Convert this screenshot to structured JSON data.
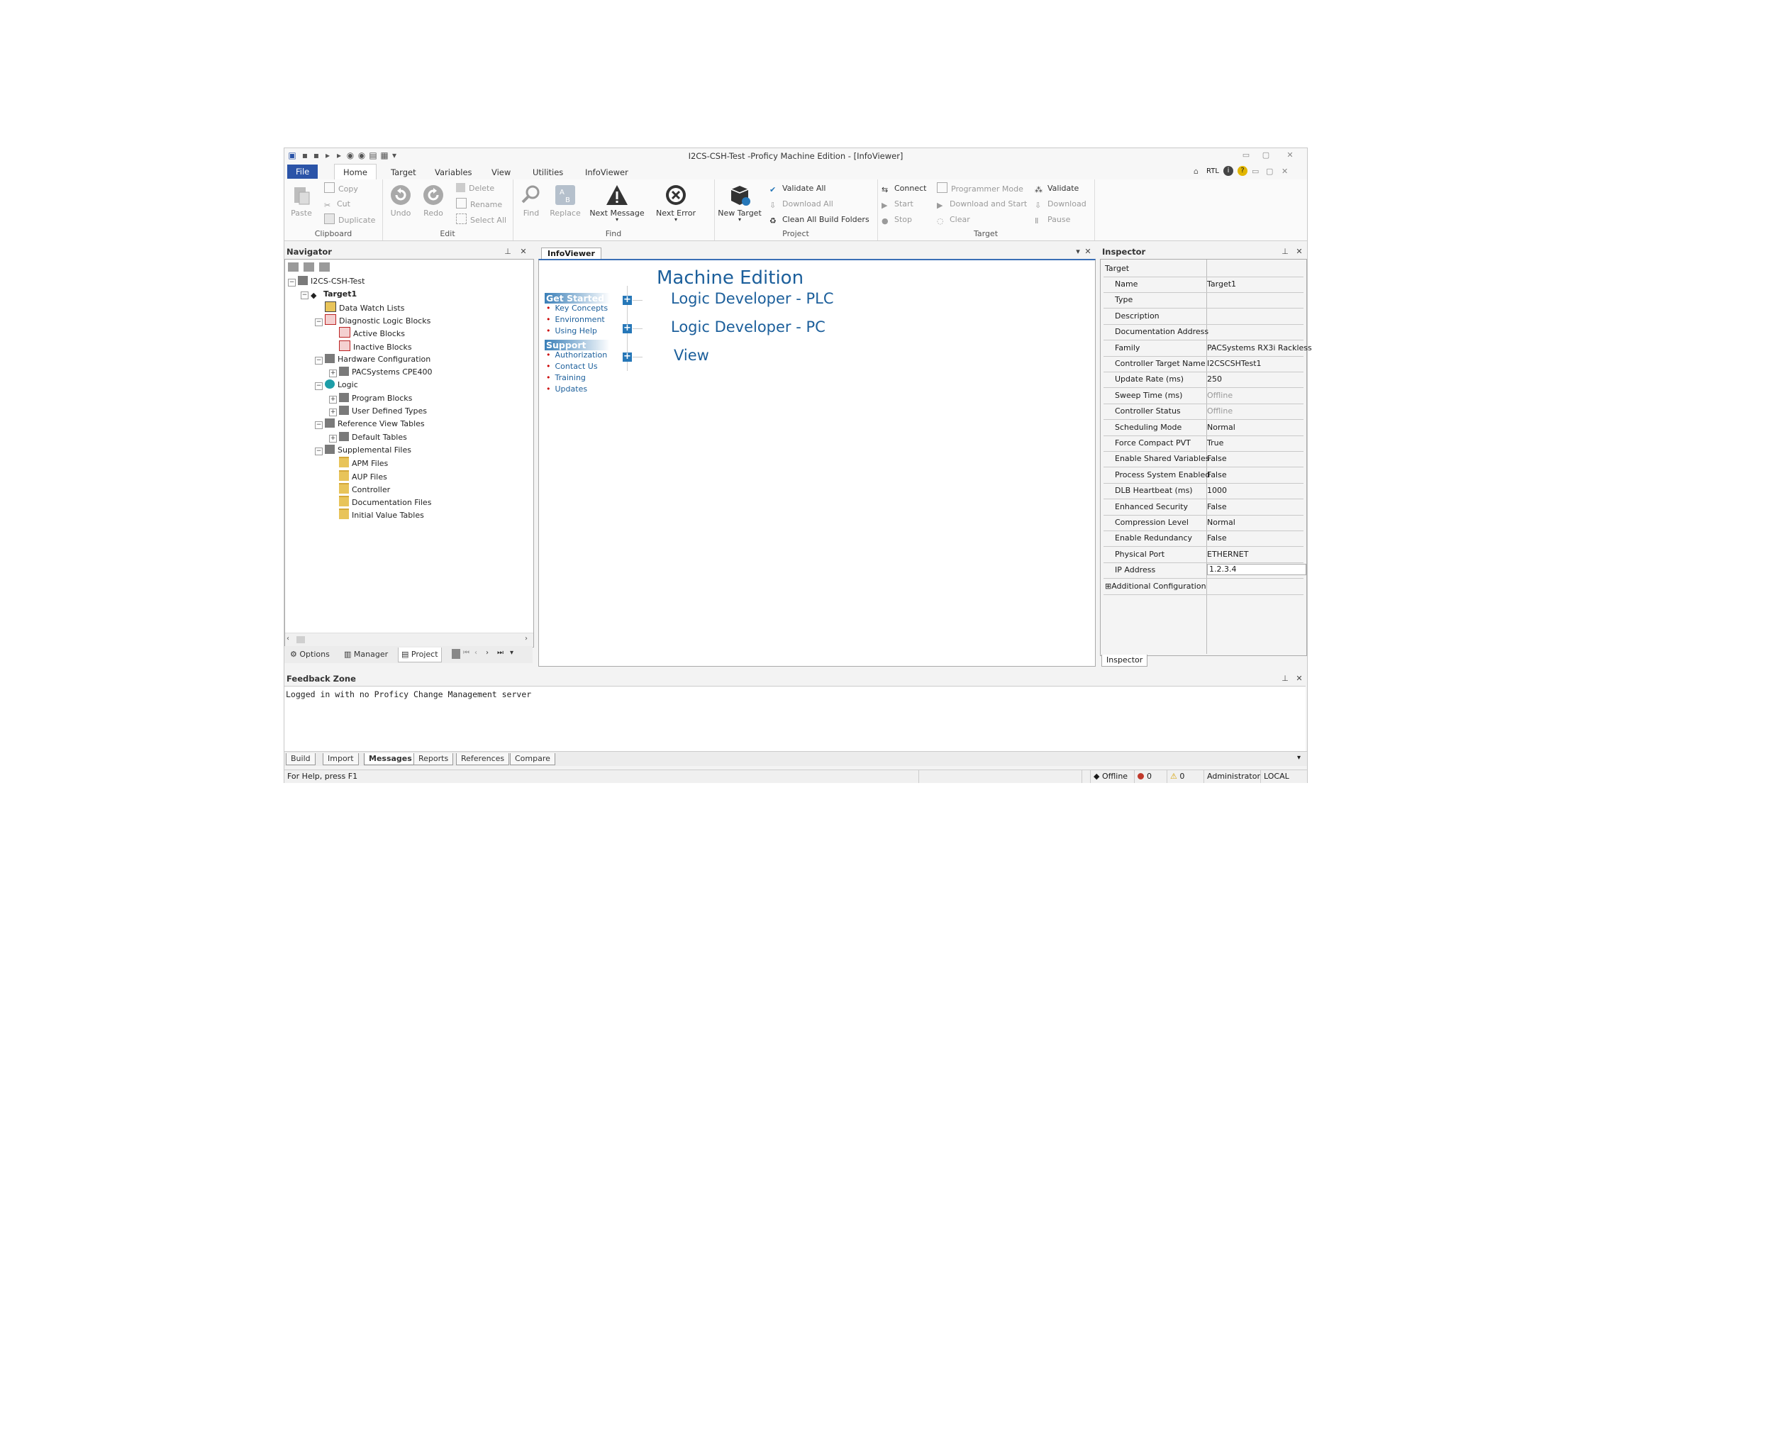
{
  "window": {
    "title": "I2CS-CSH-Test -Proficy Machine Edition - [InfoViewer]"
  },
  "ribbon_tabs": [
    "File",
    "Home",
    "Target",
    "Variables",
    "View",
    "Utilities",
    "InfoViewer"
  ],
  "right_tools": {
    "rtl": "RTL"
  },
  "clipboard": {
    "label": "Clipboard",
    "paste": "Paste",
    "copy": "Copy",
    "cut": "Cut",
    "duplicate": "Duplicate"
  },
  "edit": {
    "label": "Edit",
    "undo": "Undo",
    "redo": "Redo",
    "delete": "Delete",
    "rename": "Rename",
    "select_all": "Select All"
  },
  "find": {
    "label": "Find",
    "find": "Find",
    "replace": "Replace",
    "next_message": "Next Message",
    "next_error": "Next Error"
  },
  "project": {
    "label": "Project",
    "new_target": "New Target",
    "validate_all": "Validate All",
    "download_all": "Download All",
    "clean_all": "Clean All Build Folders"
  },
  "target": {
    "label": "Target",
    "connect": "Connect",
    "start": "Start",
    "stop": "Stop",
    "programmer_mode": "Programmer Mode",
    "download_and_start": "Download and Start",
    "clear": "Clear",
    "validate": "Validate",
    "download": "Download",
    "pause": "Pause"
  },
  "navigator": {
    "title": "Navigator",
    "tree": [
      {
        "label": "I2CS-CSH-Test",
        "level": 0,
        "exp": "−",
        "icon": "project-icon"
      },
      {
        "label": "Target1",
        "level": 1,
        "exp": "−",
        "icon": "target-icon",
        "bold": true
      },
      {
        "label": "Data Watch Lists",
        "level": 2,
        "exp": "",
        "icon": "watch-list-icon"
      },
      {
        "label": "Diagnostic Logic Blocks",
        "level": 2,
        "exp": "−",
        "icon": "diagnostic-icon"
      },
      {
        "label": "Active Blocks",
        "level": 3,
        "exp": "",
        "icon": "active-blocks-icon"
      },
      {
        "label": "Inactive Blocks",
        "level": 3,
        "exp": "",
        "icon": "inactive-blocks-icon"
      },
      {
        "label": "Hardware Configuration",
        "level": 2,
        "exp": "−",
        "icon": "hardware-icon"
      },
      {
        "label": "PACSystems CPE400",
        "level": 3,
        "exp": "+",
        "icon": "cpu-module-icon"
      },
      {
        "label": "Logic",
        "level": 2,
        "exp": "−",
        "icon": "logic-icon"
      },
      {
        "label": "Program Blocks",
        "level": 3,
        "exp": "+",
        "icon": "program-blocks-icon"
      },
      {
        "label": "User Defined Types",
        "level": 3,
        "exp": "+",
        "icon": "udt-icon"
      },
      {
        "label": "Reference View Tables",
        "level": 2,
        "exp": "−",
        "icon": "ref-tables-icon"
      },
      {
        "label": "Default Tables",
        "level": 3,
        "exp": "+",
        "icon": "default-tables-icon"
      },
      {
        "label": "Supplemental Files",
        "level": 2,
        "exp": "−",
        "icon": "supplemental-icon"
      },
      {
        "label": "APM Files",
        "level": 3,
        "exp": "",
        "icon": "folder-icon"
      },
      {
        "label": "AUP Files",
        "level": 3,
        "exp": "",
        "icon": "folder-icon"
      },
      {
        "label": "Controller",
        "level": 3,
        "exp": "",
        "icon": "folder-icon"
      },
      {
        "label": "Documentation Files",
        "level": 3,
        "exp": "",
        "icon": "folder-icon"
      },
      {
        "label": "Initial Value Tables",
        "level": 3,
        "exp": "",
        "icon": "folder-icon"
      }
    ],
    "tabs": [
      "Options",
      "Manager",
      "Project"
    ]
  },
  "infoviewer": {
    "tab": "InfoViewer",
    "heading": "Machine Edition",
    "get_started": "Get Started",
    "get_started_links": [
      "Key Concepts",
      "Environment",
      "Using Help"
    ],
    "support": "Support",
    "support_links": [
      "Authorization",
      "Contact Us",
      "Training",
      "Updates"
    ],
    "sections": [
      "Logic Developer - PLC",
      "Logic Developer - PC",
      "View"
    ]
  },
  "inspector": {
    "title": "Inspector",
    "header": "Target",
    "properties": [
      {
        "name": "Name",
        "value": "Target1"
      },
      {
        "name": "Type",
        "value": ""
      },
      {
        "name": "Description",
        "value": ""
      },
      {
        "name": "Documentation Address",
        "value": ""
      },
      {
        "name": "Family",
        "value": "PACSystems RX3i Rackless"
      },
      {
        "name": "Controller Target Name",
        "value": "I2CSCSHTest1"
      },
      {
        "name": "Update Rate (ms)",
        "value": "250"
      },
      {
        "name": "Sweep Time (ms)",
        "value": "Offline",
        "gray": true
      },
      {
        "name": "Controller Status",
        "value": "Offline",
        "gray": true
      },
      {
        "name": "Scheduling Mode",
        "value": "Normal"
      },
      {
        "name": "Force Compact PVT",
        "value": "True"
      },
      {
        "name": "Enable Shared Variables",
        "value": "False"
      },
      {
        "name": "Process System Enabled",
        "value": "False"
      },
      {
        "name": "DLB Heartbeat (ms)",
        "value": "1000"
      },
      {
        "name": "Enhanced Security",
        "value": "False"
      },
      {
        "name": "Compression Level",
        "value": "Normal"
      },
      {
        "name": "Enable Redundancy",
        "value": "False"
      },
      {
        "name": "Physical Port",
        "value": "ETHERNET"
      },
      {
        "name": "IP Address",
        "value": "1.2.3.4"
      }
    ],
    "additional": "Additional Configuration",
    "tab": "Inspector"
  },
  "feedback": {
    "title": "Feedback Zone",
    "message": "Logged in with no Proficy Change Management server",
    "tabs": [
      "Build",
      "Import",
      "Messages",
      "Reports",
      "References",
      "Compare"
    ]
  },
  "status": {
    "help": "For Help, press F1",
    "connection": "Offline",
    "errors": "0",
    "warnings": "0",
    "user": "Administrator",
    "location": "LOCAL"
  }
}
